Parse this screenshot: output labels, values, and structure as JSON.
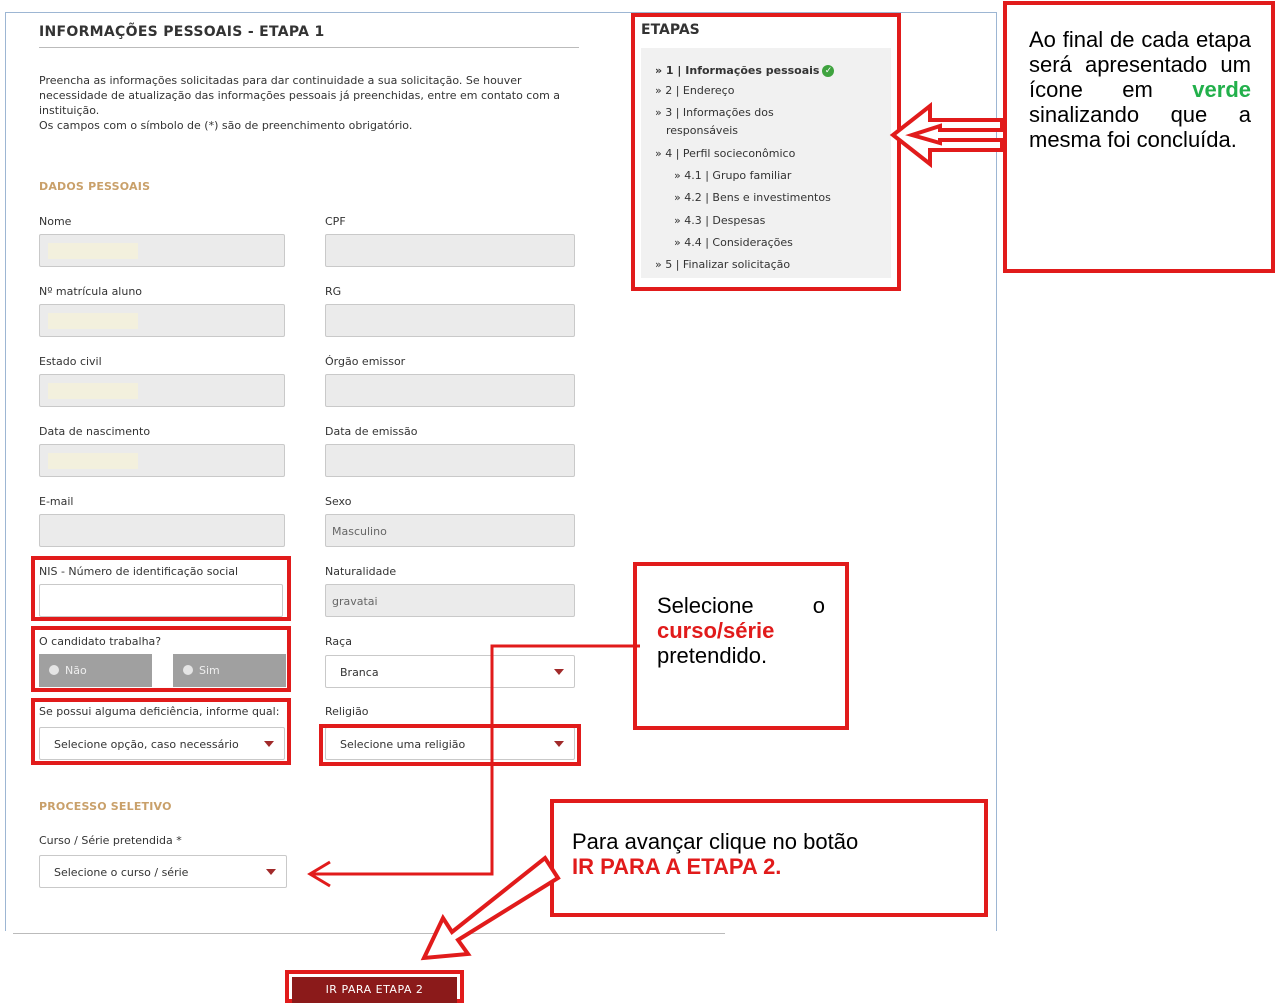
{
  "form": {
    "title": "INFORMAÇÕES PESSOAIS - ETAPA 1",
    "intro": "Preencha as informações solicitadas para dar continuidade a sua solicitação. Se houver necessidade de atualização das informações pessoais já preenchidas, entre em contato com a instituição.",
    "intro_required": "Os campos com o símbolo de (*) são de preenchimento obrigatório.",
    "section_personal": "DADOS PESSOAIS",
    "labels": {
      "nome": "Nome",
      "cpf": "CPF",
      "matricula": "Nº matrícula aluno",
      "rg": "RG",
      "estado_civil": "Estado civil",
      "orgao_emissor": "Órgão emissor",
      "nascimento": "Data de nascimento",
      "emissao": "Data de emissão",
      "email": "E-mail",
      "sexo": "Sexo",
      "nis": "NIS - Número de identificação social",
      "naturalidade": "Naturalidade",
      "trabalha": "O candidato trabalha?",
      "raca": "Raça",
      "deficiencia": "Se possui alguma deficiência, informe qual:",
      "religiao": "Religião",
      "curso": "Curso / Série pretendida *"
    },
    "values": {
      "sexo": "Masculino",
      "naturalidade": "gravatai",
      "raca": "Branca",
      "deficiencia": "Selecione opção, caso necessário",
      "religiao": "Selecione uma religião",
      "curso": "Selecione o curso / série",
      "radio_nao": "Não",
      "radio_sim": "Sim"
    },
    "section_process": "PROCESSO SELETIVO",
    "submit_button": "IR PARA ETAPA 2"
  },
  "steps": {
    "title": "ETAPAS",
    "items": [
      {
        "label": "» 1 | Informações pessoais",
        "done": true
      },
      {
        "label": "» 2 | Endereço"
      },
      {
        "label": "» 3 | Informações dos"
      },
      {
        "label": "responsáveis"
      },
      {
        "label": "» 4 | Perfil socieconômico"
      },
      {
        "label": "» 4.1 | Grupo familiar"
      },
      {
        "label": "» 4.2 | Bens e investimentos"
      },
      {
        "label": "» 4.3 | Despesas"
      },
      {
        "label": "» 4.4 | Considerações"
      },
      {
        "label": "» 5 | Finalizar solicitação"
      }
    ]
  },
  "callouts": {
    "final_a": "Ao final de cada etapa será apresentado um ícone em",
    "final_green": "verde",
    "final_b": "sinalizando que a mesma foi concluída.",
    "select_a": "Selecione o",
    "select_red": "curso/série",
    "select_b": "pretendido.",
    "advance_a": "Para avançar clique no botão",
    "advance_red": "IR PARA A ETAPA 2."
  },
  "colors": {
    "annotation_red": "#e11b1b",
    "green": "#22b04b",
    "section_gold": "#c9a06a",
    "button_bg": "#8b1a1a"
  }
}
